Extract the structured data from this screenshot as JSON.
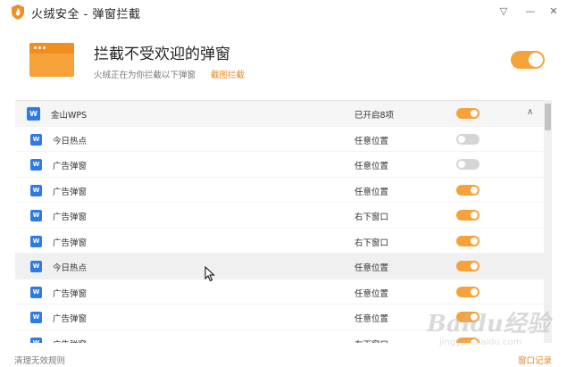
{
  "window": {
    "title": "火绒安全 - 弹窗拦截",
    "buttons": [
      "▽",
      "—",
      "✕"
    ]
  },
  "hero": {
    "title": "拦截不受欢迎的弹窗",
    "subtitle": "火绒正在为你拦截以下弹窗",
    "link": "截图拦截",
    "master_toggle": true,
    "accent": "#f5a23a"
  },
  "list": {
    "group": {
      "icon": "wps-icon",
      "name": "金山WPS",
      "status": "已开启8项",
      "enabled": true,
      "expanded": true
    },
    "items": [
      {
        "name": "今日热点",
        "position": "任意位置",
        "enabled": false
      },
      {
        "name": "广告弹窗",
        "position": "任意位置",
        "enabled": false
      },
      {
        "name": "广告弹窗",
        "position": "任意位置",
        "enabled": true
      },
      {
        "name": "广告弹窗",
        "position": "右下窗口",
        "enabled": true
      },
      {
        "name": "广告弹窗",
        "position": "右下窗口",
        "enabled": true
      },
      {
        "name": "今日热点",
        "position": "任意位置",
        "enabled": true
      },
      {
        "name": "广告弹窗",
        "position": "任意位置",
        "enabled": true
      },
      {
        "name": "广告弹窗",
        "position": "任意位置",
        "enabled": true
      },
      {
        "name": "广告弹窗",
        "position": "右下窗口",
        "enabled": true
      }
    ]
  },
  "footer": {
    "left": "清理无效规则",
    "right": "窗口记录"
  },
  "watermark": {
    "text": "Baidu经验",
    "url": "jingyan.baidu.com"
  }
}
